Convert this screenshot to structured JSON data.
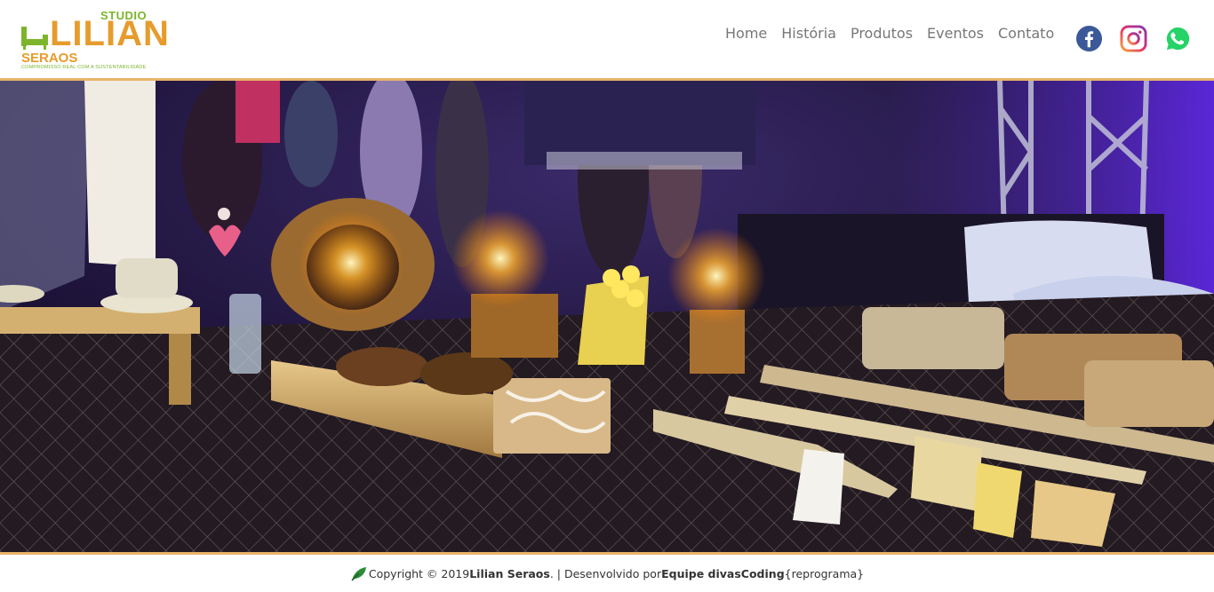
{
  "logo": {
    "studio": "STUDIO",
    "name": "LILIAN",
    "surname": "SERAOS",
    "tagline": "COMPROMISSO REAL COM A SUSTENTABILIDADE"
  },
  "nav": [
    "Home",
    "História",
    "Produtos",
    "Eventos",
    "Contato"
  ],
  "social": [
    {
      "icon": "facebook-icon",
      "color": "#3b5998"
    },
    {
      "icon": "instagram-icon",
      "color": "#c13584"
    },
    {
      "icon": "whatsapp-icon",
      "color": "#25d366"
    }
  ],
  "hero": {
    "description_icon": "event-photo"
  },
  "footer": {
    "prefix": "Copyright © 2019 ",
    "owner": "Lilian Seraos",
    "middle": ". | Desenvolvido por ",
    "team": "Equipe divasCoding",
    "suffix": " {reprograma}"
  },
  "colors": {
    "accent": "#e8b46a",
    "brand_orange": "#e69c2c",
    "brand_green": "#7cb52b"
  }
}
